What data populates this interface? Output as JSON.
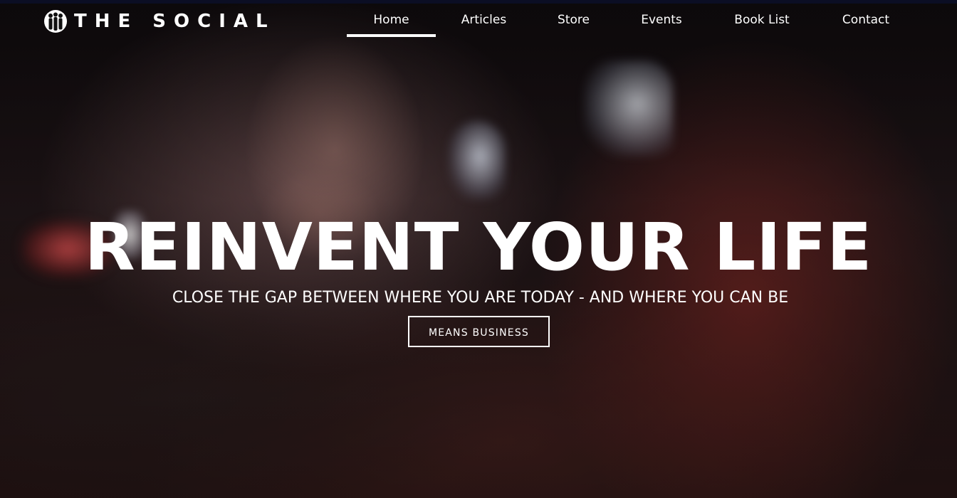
{
  "brand": {
    "name": "THE SOCIAL",
    "logo_icon": "people-group-icon"
  },
  "nav": {
    "items": [
      {
        "label": "Home",
        "active": true
      },
      {
        "label": "Articles",
        "active": false
      },
      {
        "label": "Store",
        "active": false
      },
      {
        "label": "Events",
        "active": false
      },
      {
        "label": "Book List",
        "active": false
      },
      {
        "label": "Contact",
        "active": false
      }
    ]
  },
  "hero": {
    "headline": "REINVENT YOUR LIFE",
    "subheadline": "CLOSE THE GAP BETWEEN WHERE YOU ARE TODAY - AND WHERE YOU CAN BE",
    "cta_label": "MEANS BUSINESS",
    "background_image": "woman-in-dim-room-photo"
  },
  "colors": {
    "text": "#ffffff",
    "accent_underline": "#ffffff",
    "top_rule": "#0b0e24"
  }
}
